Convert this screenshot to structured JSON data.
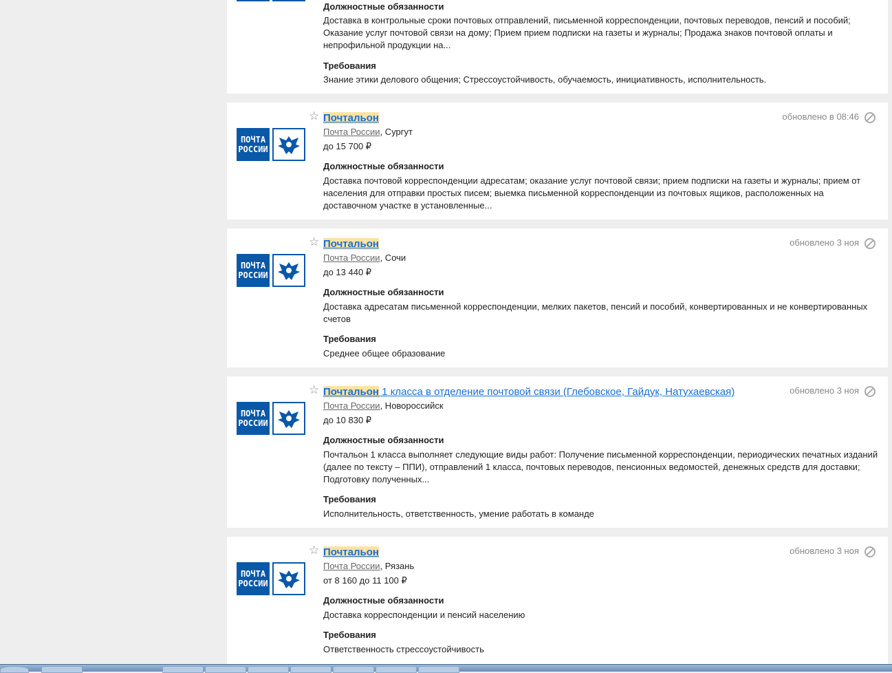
{
  "logo_text": [
    "ПОЧТА",
    "РОССИИ"
  ],
  "cards": [
    {
      "duties_heading": "Должностные обязанности",
      "duties": "Доставка в контрольные сроки почтовых отправлений, письменной корреспонденции, почтовых переводов, пенсий и пособий; Оказание услуг почтовой связи на дому; Прием прием подписки на газеты и журналы; Продажа знаков почтовой оплаты и непрофильной продукции на...",
      "req_heading": "Требования",
      "requirements": "Знание этики делового общения; Стрессоустойчивость, обучаемость, инициативность, исполнительность."
    },
    {
      "title_hl": "Почтальон",
      "title_rest": "",
      "updated": "обновлено в 08:46",
      "employer": "Почта России",
      "city": ", Сургут",
      "salary": "до 15 700 ₽",
      "duties_heading": "Должностные обязанности",
      "duties": "Доставка почтовой корреспонденции адресатам; оказание услуг почтовой связи; прием подписки на газеты и журналы; прием от населения для отправки простых писем; выемка письменной корреспонденции из почтовых ящиков, расположенных на доставочном участке в установленные..."
    },
    {
      "title_hl": "Почтальон",
      "title_rest": "",
      "updated": "обновлено 3 ноя",
      "employer": "Почта России",
      "city": ", Сочи",
      "salary": "до 13 440 ₽",
      "duties_heading": "Должностные обязанности",
      "duties": "Доставка адресатам письменной корреспонденции, мелких пакетов, пенсий и пособий, конвертированных и не конвертированных счетов",
      "req_heading": "Требования",
      "requirements": "Среднее общее образование"
    },
    {
      "title_hl": "Почтальон",
      "title_rest": " 1 класса в отделение почтовой связи (Глебовское, Гайдук, Натухаевская)",
      "updated": "обновлено 3 ноя",
      "employer": "Почта России",
      "city": ", Новороссийск",
      "salary": "до 10 830 ₽",
      "duties_heading": "Должностные обязанности",
      "duties": "Почтальон 1 класса выполняет следующие виды работ: Получение письменной корреспонденции, периодических печатных изданий (далее по тексту – ППИ), отправлений 1 класса, почтовых переводов, пенсионных ведомостей, денежных средств для доставки; Подготовку полученных...",
      "req_heading": "Требования",
      "requirements": "Исполнительность, ответственность, умение работать в команде"
    },
    {
      "title_hl": "Почтальон",
      "title_rest": "",
      "updated": "обновлено 3 ноя",
      "employer": "Почта России",
      "city": ", Рязань",
      "salary": "от 8 160 до 11 100 ₽",
      "duties_heading": "Должностные обязанности",
      "duties": "Доставка корреспонденции и пенсий населению",
      "req_heading": "Требования",
      "requirements": "Ответственность стрессоустойчивость"
    }
  ]
}
